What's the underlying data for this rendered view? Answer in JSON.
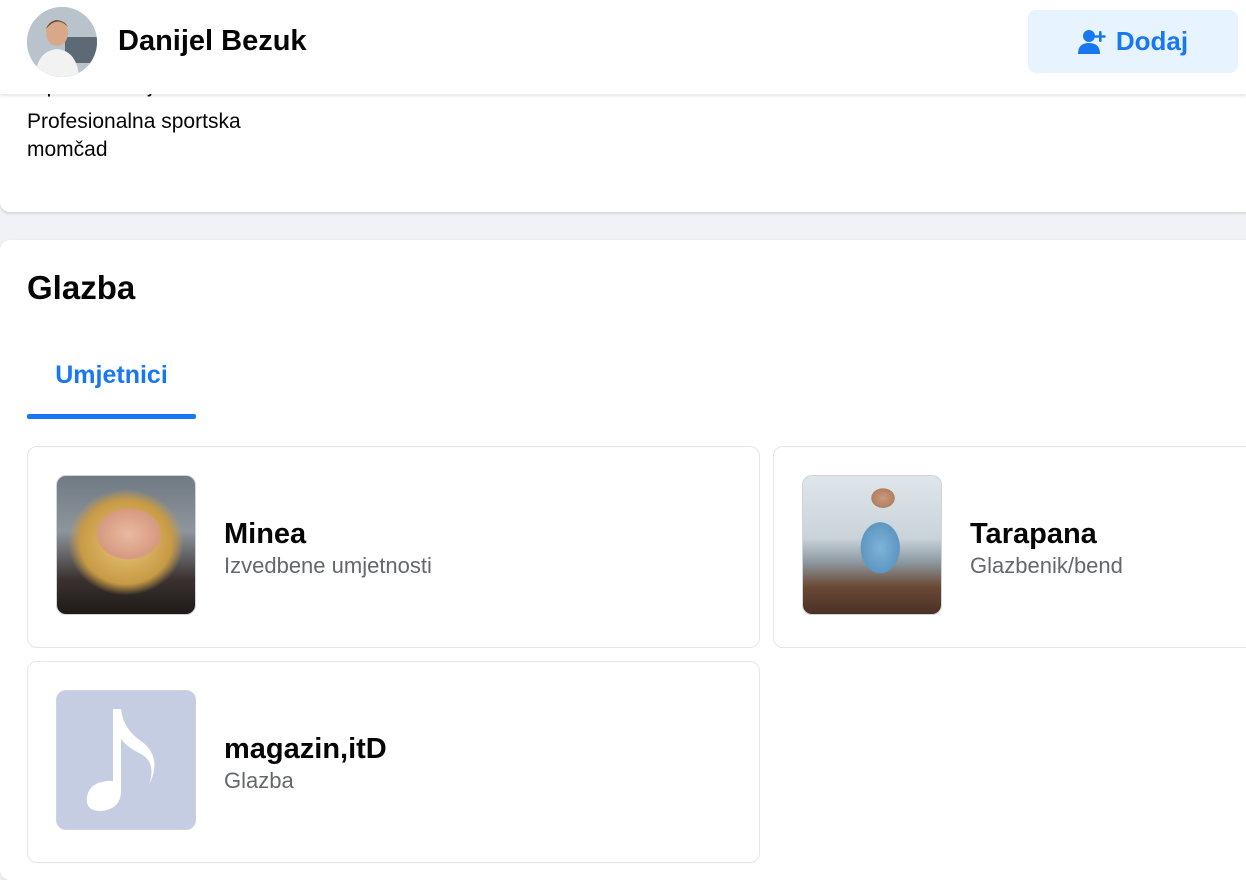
{
  "profile": {
    "name": "Danijel Bezuk",
    "add_button_label": "Dodaj"
  },
  "previous_section": {
    "cut_off_text": "reprezentacija:",
    "category_text": "Profesionalna sportska momčad"
  },
  "music": {
    "title": "Glazba",
    "tabs": [
      {
        "label": "Umjetnici",
        "active": true
      }
    ],
    "items": [
      {
        "name": "Minea",
        "category": "Izvedbene umjetnosti",
        "thumbnail": "photo"
      },
      {
        "name": "Tarapana",
        "category": "Glazbenik/bend",
        "thumbnail": "photo"
      },
      {
        "name": "magazin,itD",
        "category": "Glazba",
        "thumbnail": "music-note-icon"
      }
    ]
  },
  "colors": {
    "accent": "#1877f2",
    "button_bg": "#e7f3ff",
    "page_bg": "#f0f2f5",
    "secondary_text": "#65676b",
    "placeholder_thumb": "#c5cde2"
  }
}
